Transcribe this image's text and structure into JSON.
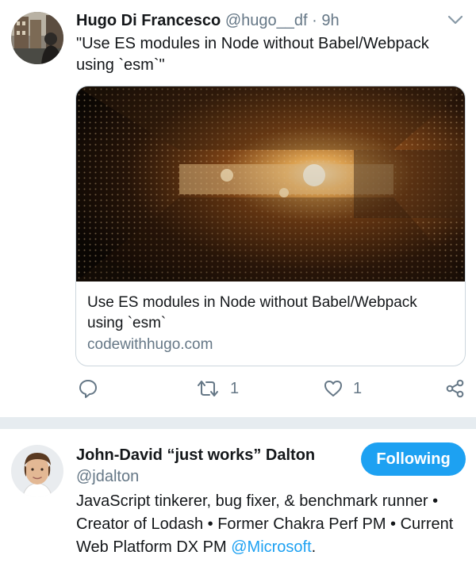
{
  "tweet": {
    "author_name": "Hugo Di Francesco",
    "handle": "@hugo__df",
    "separator": "·",
    "time": "9h",
    "text": "\"Use ES modules in Node without Babel/Webpack using `esm`\"",
    "card": {
      "title": "Use ES modules in Node without Babel/Webpack using `esm`",
      "domain": "codewithhugo.com"
    },
    "actions": {
      "reply_icon": "reply-icon",
      "retweet_icon": "retweet-icon",
      "retweet_count": "1",
      "like_icon": "heart-icon",
      "like_count": "1",
      "share_icon": "share-icon"
    }
  },
  "profile": {
    "name": "John-David “just works” Dalton",
    "handle": "@jdalton",
    "follow_label": "Following",
    "bio_text": "JavaScript tinkerer, bug fixer, & benchmark runner • Creator of Lodash • Former Chakra Perf PM • Current Web Platform DX PM ",
    "bio_mention": "@Microsoft",
    "bio_end": "."
  },
  "colors": {
    "accent": "#1da1f2",
    "muted_text": "#657786",
    "primary_text": "#14171a",
    "divider": "#e6ecf0",
    "card_border": "#ccd6dd"
  }
}
